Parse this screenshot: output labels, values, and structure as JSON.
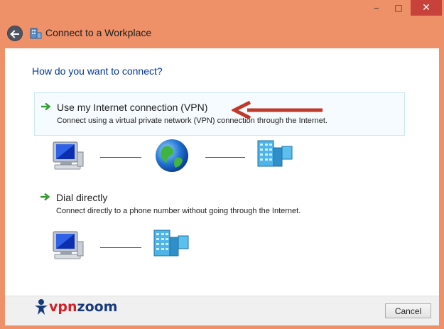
{
  "window": {
    "title": "Connect to a Workplace",
    "controls": {
      "minimize": "‒",
      "maximize": "□",
      "close": "✕"
    }
  },
  "main": {
    "heading": "How do you want to connect?",
    "options": [
      {
        "title": "Use my Internet connection (VPN)",
        "description": "Connect using a virtual private network (VPN) connection through the Internet."
      },
      {
        "title": "Dial directly",
        "description": "Connect directly to a phone number without going through the Internet."
      }
    ]
  },
  "footer": {
    "logo_part1": "vpn",
    "logo_part2": "zoom",
    "cancel_label": "Cancel"
  },
  "colors": {
    "frame": "#ee9068",
    "heading": "#003399",
    "highlight_border": "#cbe8f6",
    "annotation_arrow": "#c0392b"
  },
  "icons": [
    "back-arrow-icon",
    "workplace-icon",
    "green-arrow-icon",
    "computer-icon",
    "globe-icon",
    "server-building-icon"
  ]
}
